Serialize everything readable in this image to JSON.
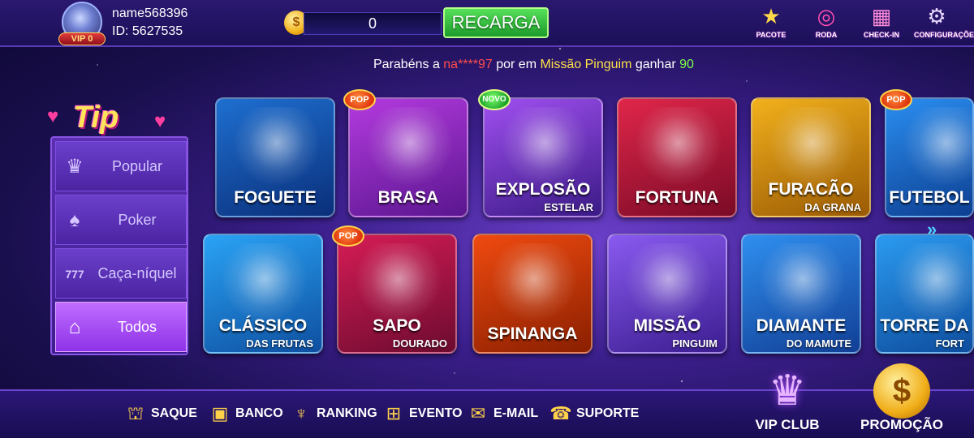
{
  "user": {
    "name": "name568396",
    "id_label": "ID: 5627535",
    "vip": "VIP 0"
  },
  "wallet": {
    "coin_icon": "coin-icon",
    "balance": "0",
    "recharge_label": "RECARGA"
  },
  "top_icons": [
    {
      "label": "PACOTE",
      "icon": "star-gift-icon"
    },
    {
      "label": "RODA",
      "icon": "wheel-icon"
    },
    {
      "label": "CHECK-IN",
      "icon": "calendar-icon"
    },
    {
      "label": "CONFIGURAÇÕES",
      "icon": "gear-icon"
    }
  ],
  "ticker": {
    "prefix": "Parabéns a ",
    "player": "na****97",
    "mid": " por em ",
    "game": "Missão Pinguim",
    "suffix": " ganhar ",
    "amount": "90"
  },
  "sidebar": {
    "logo": "Tip",
    "items": [
      {
        "label": "Popular",
        "icon": "crown-icon"
      },
      {
        "label": "Poker",
        "icon": "cards-icon"
      },
      {
        "label": "Caça-níquel",
        "icon": "slot-777-icon"
      },
      {
        "label": "Todos",
        "icon": "house-lightning-icon",
        "active": true
      }
    ]
  },
  "games_row1": [
    {
      "name": "FOGUETE",
      "sub": "",
      "tag": "",
      "color1": "#1e6fd0",
      "color2": "#0a2f7a"
    },
    {
      "name": "BRASA",
      "sub": "",
      "tag": "POP",
      "color1": "#b43adf",
      "color2": "#5a168f"
    },
    {
      "name": "EXPLOSÃO",
      "sub": "ESTELAR",
      "tag": "NOVO",
      "color1": "#a04ff0",
      "color2": "#3a1a86"
    },
    {
      "name": "FORTUNA",
      "sub": "",
      "tag": "",
      "color1": "#e0264a",
      "color2": "#7a0a26"
    },
    {
      "name": "FURACÃO",
      "sub": "DA GRANA",
      "tag": "",
      "color1": "#f2b11c",
      "color2": "#9a5a04"
    },
    {
      "name": "FUTEBOL",
      "sub": "",
      "tag": "POP",
      "color1": "#2a8ef0",
      "color2": "#0d3f92"
    }
  ],
  "games_row2": [
    {
      "name": "CLÁSSICO",
      "sub": "DAS FRUTAS",
      "tag": "",
      "color1": "#2aa3f5",
      "color2": "#0e4fa0"
    },
    {
      "name": "SAPO",
      "sub": "DOURADO",
      "tag": "POP",
      "color1": "#d61c56",
      "color2": "#6c0b2f"
    },
    {
      "name": "SPINANGA",
      "sub": "",
      "tag": "",
      "color1": "#f04a10",
      "color2": "#8a1f00"
    },
    {
      "name": "MISSÃO",
      "sub": "PINGUIM",
      "tag": "",
      "color1": "#8a5af0",
      "color2": "#3b1d90"
    },
    {
      "name": "DIAMANTE",
      "sub": "DO MAMUTE",
      "tag": "",
      "color1": "#2f8fef",
      "color2": "#113f96"
    },
    {
      "name": "TORRE DA",
      "sub": "FORT",
      "tag": "",
      "color1": "#2b9bf0",
      "color2": "#0e4d9e"
    }
  ],
  "bottom_nav": [
    {
      "label": "SAQUE",
      "icon": "bank-icon"
    },
    {
      "label": "BANCO",
      "icon": "safe-icon"
    },
    {
      "label": "RANKING",
      "icon": "trophy-icon"
    },
    {
      "label": "EVENTO",
      "icon": "gift-icon"
    },
    {
      "label": "E-MAIL",
      "icon": "envelope-icon"
    },
    {
      "label": "SUPORTE",
      "icon": "support-24h-icon"
    }
  ],
  "vip_club": {
    "label": "VIP CLUB",
    "icon": "vip-crown-icon"
  },
  "promotion": {
    "label": "PROMOÇÃO",
    "icon": "money-bag-icon"
  }
}
